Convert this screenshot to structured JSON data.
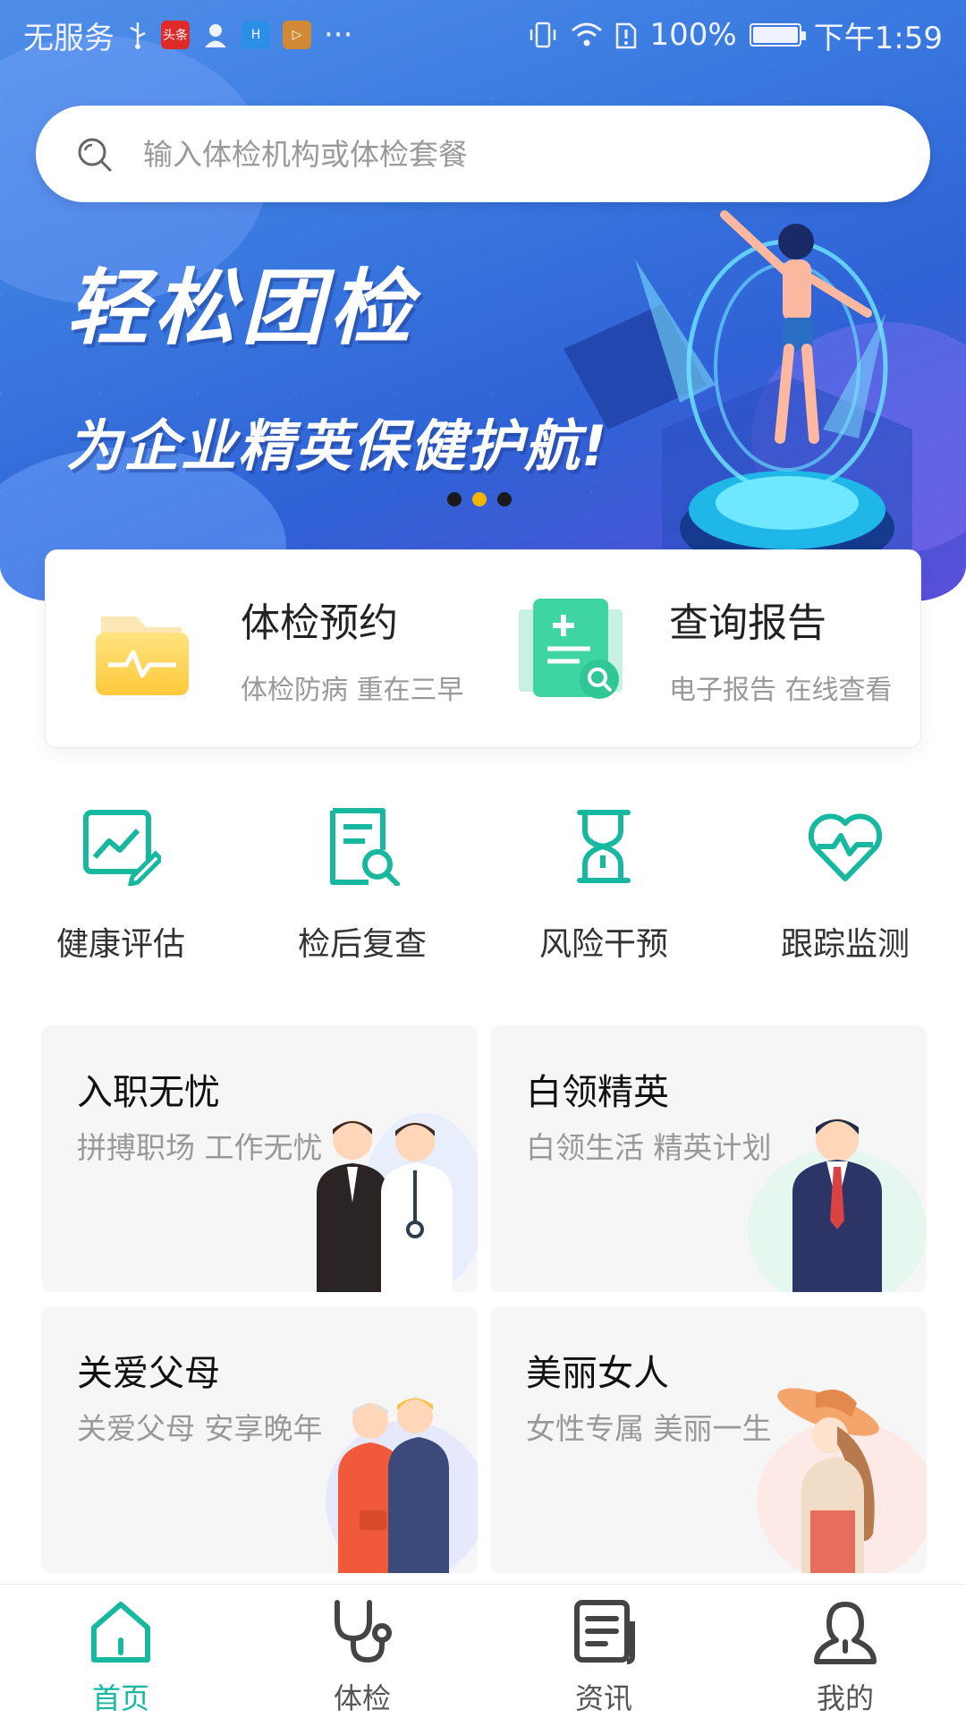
{
  "colors": {
    "accent": "#16b8a0",
    "banner_blue": "#3a7ae0",
    "dot_active": "#f5b400"
  },
  "status_bar": {
    "carrier": "无服务",
    "battery": "100%",
    "battery_level": 1.0,
    "time": "下午1:59",
    "icons": [
      "usb-icon",
      "toutiao-icon",
      "contacts-icon",
      "app-icon",
      "video-icon",
      "more-icon",
      "vibrate-icon",
      "wifi-icon",
      "sim-alert-icon",
      "battery-icon"
    ],
    "toutiao_text": "头条",
    "more": "···"
  },
  "search": {
    "placeholder": "输入体检机构或体检套餐",
    "icon": "search-icon"
  },
  "banner": {
    "title": "轻松团检",
    "subtitle": "为企业精英保健护航!",
    "page_count": 3,
    "active_page": 2
  },
  "services": [
    {
      "title": "体检预约",
      "desc": "体检防病 重在三早",
      "icon": "folder-heartbeat-icon"
    },
    {
      "title": "查询报告",
      "desc": "电子报告 在线查看",
      "icon": "report-search-icon"
    }
  ],
  "features": [
    {
      "label": "健康评估",
      "icon": "chart-edit-icon"
    },
    {
      "label": "检后复查",
      "icon": "document-search-icon"
    },
    {
      "label": "风险干预",
      "icon": "hourglass-icon"
    },
    {
      "label": "跟踪监测",
      "icon": "heart-pulse-icon"
    }
  ],
  "packages": [
    {
      "title": "入职无忧",
      "sub": "拼搏职场 工作无忧"
    },
    {
      "title": "白领精英",
      "sub": "白领生活 精英计划"
    },
    {
      "title": "关爱父母",
      "sub": "关爱父母 安享晚年"
    },
    {
      "title": "美丽女人",
      "sub": "女性专属 美丽一生"
    }
  ],
  "nav": [
    {
      "label": "首页",
      "icon": "home-icon",
      "active": true
    },
    {
      "label": "体检",
      "icon": "stethoscope-icon",
      "active": false
    },
    {
      "label": "资讯",
      "icon": "news-icon",
      "active": false
    },
    {
      "label": "我的",
      "icon": "user-icon",
      "active": false
    }
  ]
}
